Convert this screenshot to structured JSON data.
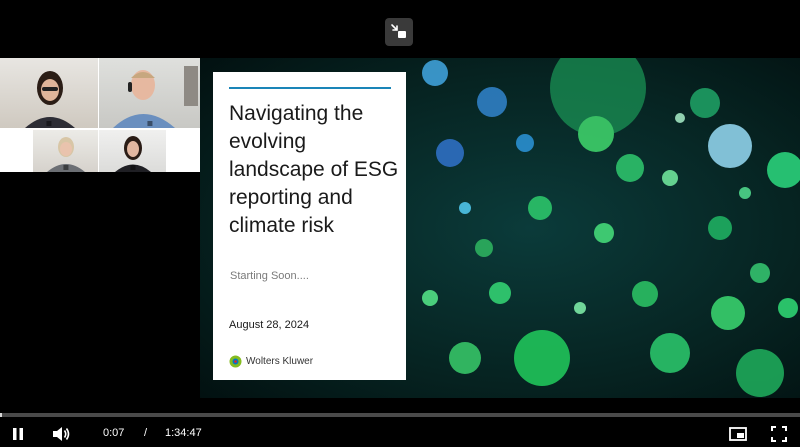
{
  "player": {
    "exit_fullscreen_icon": "exit-fullscreen-icon",
    "current_time": "0:07",
    "separator": "/",
    "duration": "1:34:47",
    "progress_fraction": 0.0012,
    "icons": {
      "play_pause": "pause-icon",
      "volume": "volume-icon",
      "pip": "picture-in-picture-icon",
      "fullscreen": "fullscreen-icon"
    }
  },
  "slide": {
    "title": "Navigating the evolving landscape of ESG reporting and climate risk",
    "status": "Starting Soon....",
    "date": "August 28, 2024",
    "brand": "Wolters Kluwer",
    "accent_color": "#1a85b8"
  },
  "participants": [
    {
      "id": "p1",
      "hair": "#2b1d16",
      "shirt": "#2d2d35"
    },
    {
      "id": "p2",
      "hair": "#c7a77f",
      "shirt": "#6a8fbf"
    },
    {
      "id": "p3",
      "hair": "#d8c6a6",
      "shirt": "#6c6f74"
    },
    {
      "id": "p4",
      "hair": "#2a1c16",
      "shirt": "#1f1f24"
    }
  ]
}
